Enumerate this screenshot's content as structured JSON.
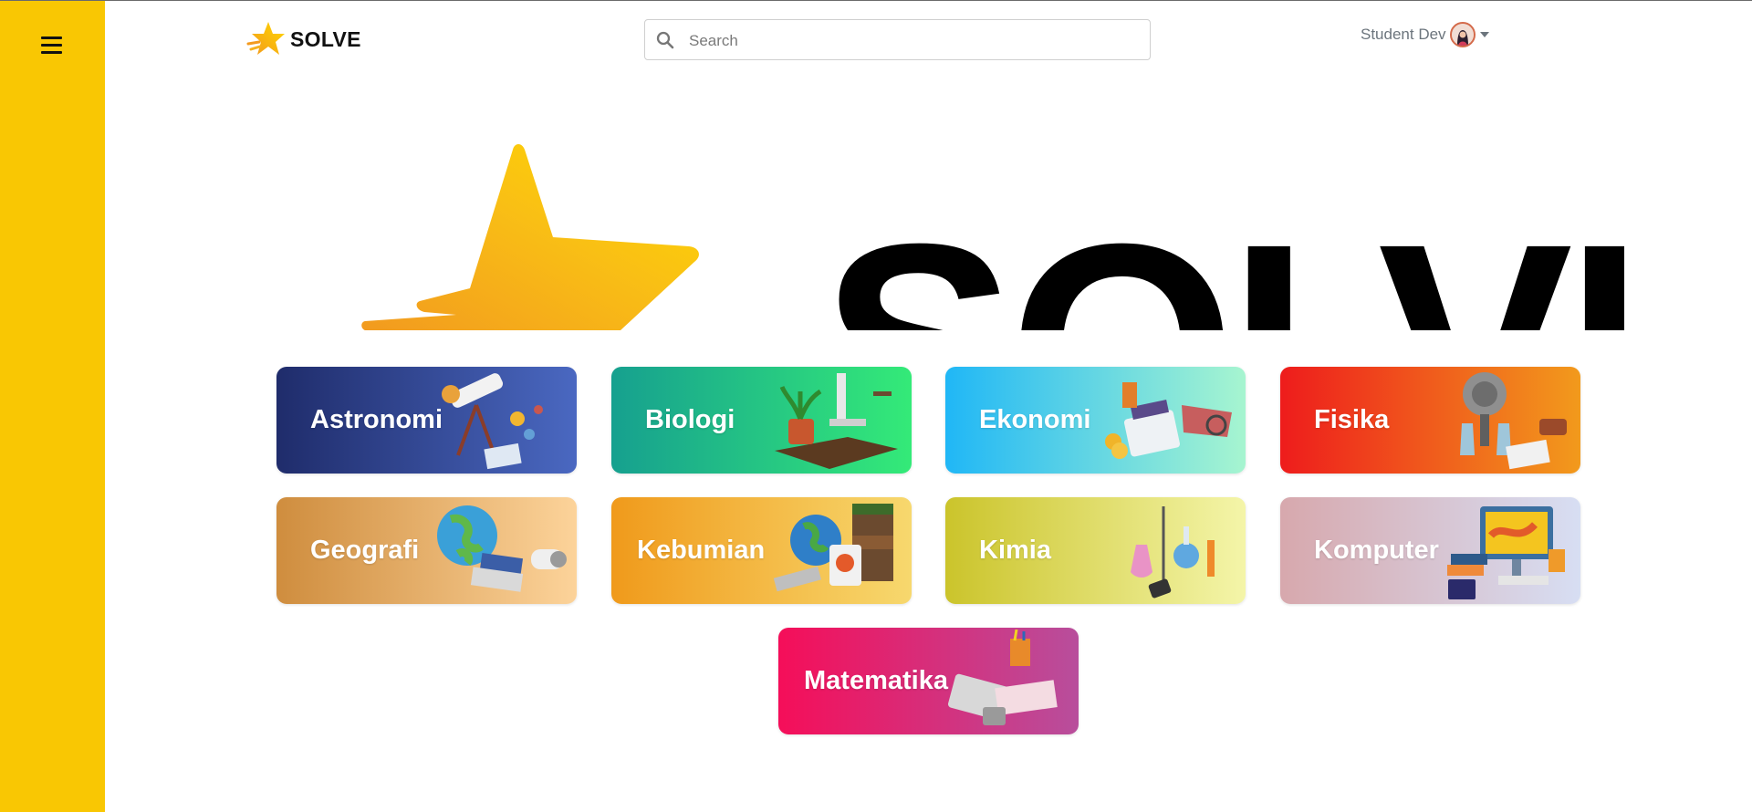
{
  "app": {
    "brand_name": "SOLVE",
    "hero_text": "SOLVE"
  },
  "sidebar": {
    "menu_icon": "hamburger-icon",
    "color": "#f9c703"
  },
  "search": {
    "placeholder": "Search",
    "value": "",
    "icon": "search-icon"
  },
  "user": {
    "name": "Student Dev",
    "avatar": "avatar",
    "menu_icon": "caret-down-icon"
  },
  "subjects": [
    {
      "label": "Astronomi",
      "icon": "telescope-illustration",
      "colors": [
        "#1f2c6b",
        "#4a68c1"
      ]
    },
    {
      "label": "Biologi",
      "icon": "microscope-plant-illustration",
      "colors": [
        "#16a08f",
        "#34ea78"
      ]
    },
    {
      "label": "Ekonomi",
      "icon": "calculator-coins-illustration",
      "colors": [
        "#20b7f6",
        "#a7f5d0"
      ]
    },
    {
      "label": "Fisika",
      "icon": "physics-lab-illustration",
      "colors": [
        "#ee1c1c",
        "#f29a1c"
      ]
    },
    {
      "label": "Geografi",
      "icon": "globe-illustration",
      "colors": [
        "#cf8d3e",
        "#fcd39a"
      ]
    },
    {
      "label": "Kebumian",
      "icon": "globe-earth-layers-illustration",
      "colors": [
        "#f09a1b",
        "#f7d86e"
      ]
    },
    {
      "label": "Kimia",
      "icon": "chemistry-flasks-illustration",
      "colors": [
        "#cbc42b",
        "#f4f5a9"
      ]
    },
    {
      "label": "Komputer",
      "icon": "computer-illustration",
      "colors": [
        "#d7a8ad",
        "#d7def3"
      ]
    },
    {
      "label": "Matematika",
      "icon": "math-calculator-illustration",
      "colors": [
        "#f50e59",
        "#b84e9c"
      ]
    }
  ],
  "accent_colors": {
    "star_yellow": "#f9c703",
    "star_orange": "#f5a623"
  }
}
